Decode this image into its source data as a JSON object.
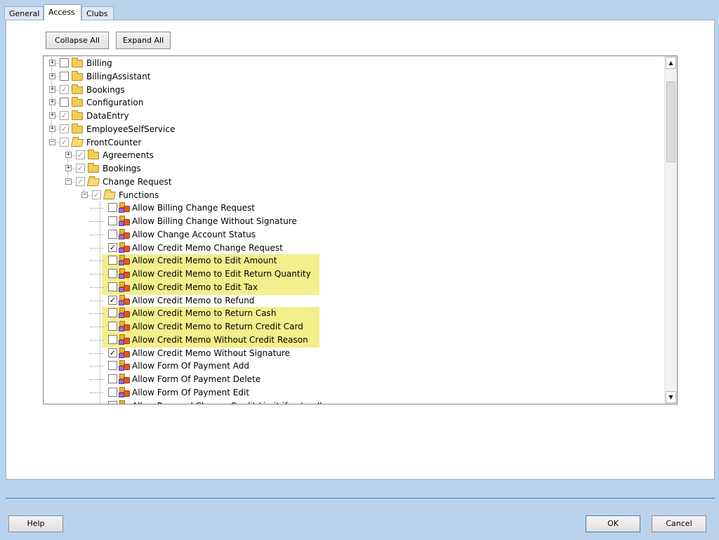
{
  "tabs": [
    {
      "label": "General",
      "active": false
    },
    {
      "label": "Access",
      "active": true
    },
    {
      "label": "Clubs",
      "active": false
    }
  ],
  "toolbar": {
    "collapse_all": "Collapse All",
    "expand_all": "Expand All"
  },
  "tree": [
    {
      "label": "Billing",
      "level": 0,
      "kind": "folder",
      "expander": "+",
      "checkbox": "empty"
    },
    {
      "label": "BillingAssistant",
      "level": 0,
      "kind": "folder",
      "expander": "+",
      "checkbox": "empty"
    },
    {
      "label": "Bookings",
      "level": 0,
      "kind": "folder",
      "expander": "+",
      "checkbox": "grey"
    },
    {
      "label": "Configuration",
      "level": 0,
      "kind": "folder",
      "expander": "+",
      "checkbox": "empty"
    },
    {
      "label": "DataEntry",
      "level": 0,
      "kind": "folder",
      "expander": "+",
      "checkbox": "grey"
    },
    {
      "label": "EmployeeSelfService",
      "level": 0,
      "kind": "folder",
      "expander": "+",
      "checkbox": "grey"
    },
    {
      "label": "FrontCounter",
      "level": 0,
      "kind": "folder-open",
      "expander": "-",
      "checkbox": "grey"
    },
    {
      "label": "Agreements",
      "level": 1,
      "kind": "folder",
      "expander": "+",
      "checkbox": "grey"
    },
    {
      "label": "Bookings",
      "level": 1,
      "kind": "folder",
      "expander": "+",
      "checkbox": "grey"
    },
    {
      "label": "Change Request",
      "level": 1,
      "kind": "folder-open",
      "expander": "-",
      "checkbox": "grey"
    },
    {
      "label": "Functions",
      "level": 2,
      "kind": "folder-open",
      "expander": "-",
      "checkbox": "grey"
    },
    {
      "label": "Allow Billing Change Request",
      "level": 3,
      "kind": "function",
      "checkbox": "empty"
    },
    {
      "label": "Allow Billing Change Without Signature",
      "level": 3,
      "kind": "function",
      "checkbox": "empty"
    },
    {
      "label": "Allow Change Account Status",
      "level": 3,
      "kind": "function",
      "checkbox": "empty"
    },
    {
      "label": "Allow Credit Memo Change Request",
      "level": 3,
      "kind": "function",
      "checkbox": "checked"
    },
    {
      "label": "Allow Credit Memo to Edit Amount",
      "level": 3,
      "kind": "function",
      "checkbox": "empty",
      "highlight": true
    },
    {
      "label": "Allow Credit Memo to Edit Return Quantity",
      "level": 3,
      "kind": "function",
      "checkbox": "empty",
      "highlight": true
    },
    {
      "label": "Allow Credit Memo to Edit Tax",
      "level": 3,
      "kind": "function",
      "checkbox": "empty",
      "highlight": true
    },
    {
      "label": "Allow Credit Memo to Refund",
      "level": 3,
      "kind": "function",
      "checkbox": "checked"
    },
    {
      "label": "Allow Credit Memo to Return Cash",
      "level": 3,
      "kind": "function",
      "checkbox": "empty",
      "highlight": true
    },
    {
      "label": "Allow Credit Memo to Return Credit Card",
      "level": 3,
      "kind": "function",
      "checkbox": "empty",
      "highlight": true
    },
    {
      "label": "Allow Credit Memo Without Credit Reason",
      "level": 3,
      "kind": "function",
      "checkbox": "empty",
      "highlight": true
    },
    {
      "label": "Allow Credit Memo Without Signature",
      "level": 3,
      "kind": "function",
      "checkbox": "checked"
    },
    {
      "label": "Allow Form Of Payment Add",
      "level": 3,
      "kind": "function",
      "checkbox": "empty"
    },
    {
      "label": "Allow Form Of Payment Delete",
      "level": 3,
      "kind": "function",
      "checkbox": "empty"
    },
    {
      "label": "Allow Form Of Payment Edit",
      "level": 3,
      "kind": "function",
      "checkbox": "empty"
    },
    {
      "label": "Allow Personal Change Credit Limit if not null",
      "level": 3,
      "kind": "function",
      "checkbox": "empty"
    }
  ],
  "highlight_color": "#f2ef8d",
  "footer": {
    "help": "Help",
    "ok": "OK",
    "cancel": "Cancel"
  }
}
